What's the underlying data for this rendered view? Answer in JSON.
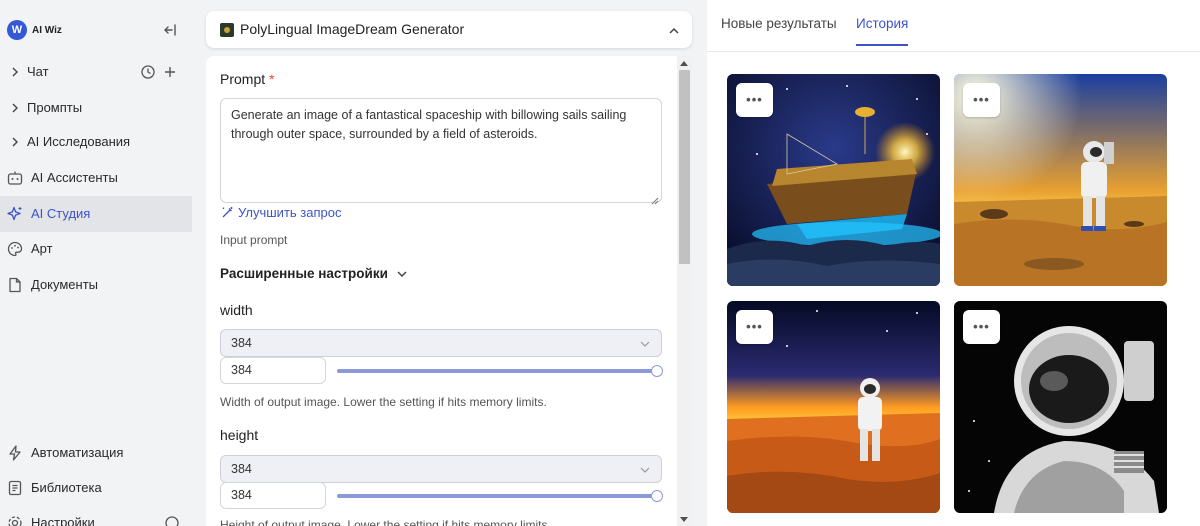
{
  "sidebar": {
    "brand": "AI Wiz",
    "brand_letter": "W",
    "items": [
      {
        "label": "Чат"
      },
      {
        "label": "Промпты"
      },
      {
        "label": "AI Исследования"
      },
      {
        "label": "AI Ассистенты"
      },
      {
        "label": "AI Студия"
      },
      {
        "label": "Арт"
      },
      {
        "label": "Документы"
      },
      {
        "label": "Автоматизация"
      },
      {
        "label": "Библиотека"
      },
      {
        "label": "Настройки"
      }
    ]
  },
  "tool": {
    "title": "PolyLingual ImageDream Generator"
  },
  "form": {
    "prompt_label": "Prompt",
    "required_mark": "*",
    "prompt_value": "Generate an image of a fantastical spaceship with billowing sails sailing through outer space, surrounded by a field of asteroids.",
    "improve_label": "Улучшить запрос",
    "prompt_help": "Input prompt",
    "advanced_label": "Расширенные настройки",
    "width": {
      "label": "width",
      "select_value": "384",
      "input_value": "384",
      "slider_fraction": 1.0,
      "help": "Width of output image. Lower the setting if hits memory limits."
    },
    "height": {
      "label": "height",
      "select_value": "384",
      "input_value": "384",
      "slider_fraction": 1.0,
      "help": "Height of output image. Lower the setting if hits memory limits."
    }
  },
  "results": {
    "tabs": [
      "Новые результаты",
      "История"
    ],
    "active_tab": "История",
    "more_label": "•••",
    "images": [
      {
        "alt": "spaceship"
      },
      {
        "alt": "astronaut-desert"
      },
      {
        "alt": "astronaut-sunset"
      },
      {
        "alt": "astronaut-portrait"
      }
    ]
  },
  "colors": {
    "accent": "#3c53c8",
    "brand": "#3458d6"
  }
}
